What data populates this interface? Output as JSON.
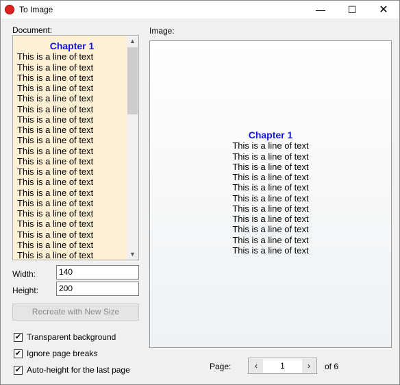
{
  "window": {
    "title": "To Image",
    "icon": "app-logo-icon"
  },
  "document": {
    "label": "Document:",
    "chapter": "Chapter 1",
    "lines": [
      "This is a line of text",
      "This is a line of text",
      "This is a line of text",
      "This is a line of text",
      "This is a line of text",
      "This is a line of text",
      "This is a line of text",
      "This is a line of text",
      "This is a line of text",
      "This is a line of text",
      "This is a line of text",
      "This is a line of text",
      "This is a line of text",
      "This is a line of text",
      "This is a line of text",
      "This is a line of text",
      "This is a line of text",
      "This is a line of text",
      "This is a line of text",
      "This is a line of text"
    ],
    "background": "#fdf0d5",
    "chapter_color": "#1010ee"
  },
  "size": {
    "width_label": "Width:",
    "width_value": "140",
    "height_label": "Height:",
    "height_value": "200",
    "recreate_label": "Recreate with New Size"
  },
  "options": [
    {
      "label": "Transparent background",
      "checked": true
    },
    {
      "label": "Ignore page breaks",
      "checked": true
    },
    {
      "label": "Auto-height for the last page",
      "checked": true
    }
  ],
  "image": {
    "label": "Image:",
    "chapter": "Chapter 1",
    "lines": [
      "This is a line of text",
      "This is a line of text",
      "This is a line of text",
      "This is a line of text",
      "This is a line of text",
      "This is a line of text",
      "This is a line of text",
      "This is a line of text",
      "This is a line of text",
      "This is a line of text",
      "This is a line of text"
    ]
  },
  "pager": {
    "label": "Page:",
    "value": "1",
    "of": "of 6"
  }
}
